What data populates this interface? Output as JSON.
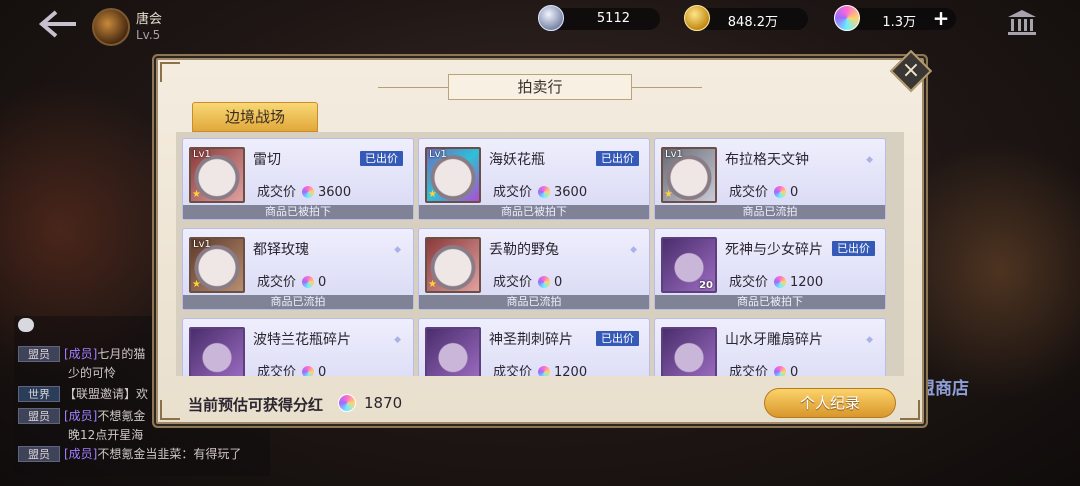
{
  "hud": {
    "player_name": "唐会",
    "player_level": "Lv.5",
    "silver": "5112",
    "gold": "848.2万",
    "gems": "1.3万",
    "plus": "+"
  },
  "chat": [
    {
      "tag": "盟员",
      "user": "[成员]",
      "text": "七月的猫"
    },
    {
      "tag": "",
      "user": "",
      "text": "少的可怜"
    },
    {
      "tag": "世界",
      "user": "",
      "text": "【联盟邀请】欢"
    },
    {
      "tag": "盟员",
      "user": "[成员]",
      "text": "不想氪金"
    },
    {
      "tag": "",
      "user": "",
      "text": "晚12点开星海"
    },
    {
      "tag": "盟员",
      "user": "[成员]",
      "text": "不想氪金当韭菜：有得玩了"
    }
  ],
  "shop_label": "盟商店",
  "dialog": {
    "title": "拍卖行",
    "close": "×",
    "tab": "边境战场",
    "price_prefix": "成交价",
    "items": [
      {
        "name": "雷切",
        "badge": "已出价",
        "price": "3600",
        "status": "商品已被拍下",
        "lv": "Lv1",
        "thumb": "red"
      },
      {
        "name": "海妖花瓶",
        "badge": "已出价",
        "price": "3600",
        "status": "商品已被拍下",
        "lv": "Lv1",
        "thumb": "blue"
      },
      {
        "name": "布拉格天文钟",
        "badge": "",
        "price": "0",
        "status": "商品已流拍",
        "lv": "Lv1",
        "thumb": "gray"
      },
      {
        "name": "都铎玫瑰",
        "badge": "",
        "price": "0",
        "status": "商品已流拍",
        "lv": "Lv1",
        "thumb": "brown"
      },
      {
        "name": "丢勒的野兔",
        "badge": "",
        "price": "0",
        "status": "商品已流拍",
        "lv": "",
        "thumb": "red"
      },
      {
        "name": "死神与少女碎片",
        "badge": "已出价",
        "price": "1200",
        "status": "商品已被拍下",
        "lv": "",
        "thumb": "purple",
        "count": "20"
      },
      {
        "name": "波特兰花瓶碎片",
        "badge": "",
        "price": "0",
        "status": "",
        "lv": "",
        "thumb": "purple"
      },
      {
        "name": "神圣荆刺碎片",
        "badge": "已出价",
        "price": "1200",
        "status": "",
        "lv": "",
        "thumb": "purple"
      },
      {
        "name": "山水牙雕扇碎片",
        "badge": "",
        "price": "0",
        "status": "",
        "lv": "",
        "thumb": "purple"
      }
    ],
    "dividend_label": "当前预估可获得分红",
    "dividend_value": "1870",
    "record_button": "个人纪录"
  }
}
